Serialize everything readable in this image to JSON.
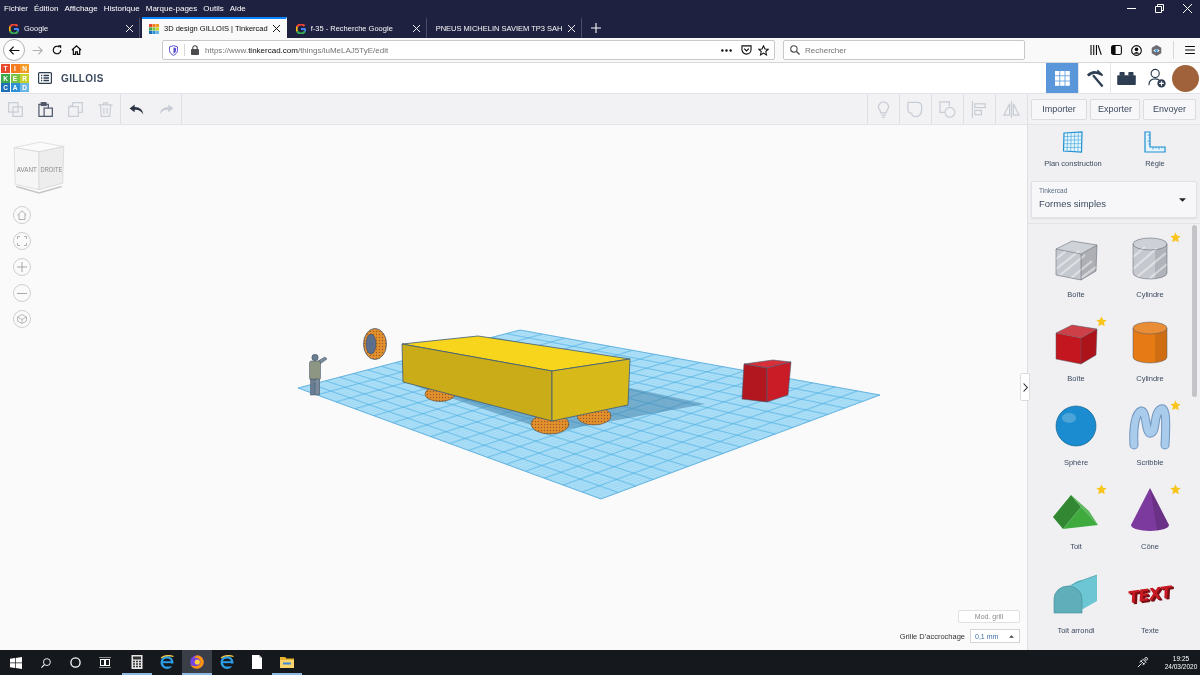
{
  "menu_bar": [
    "Fichier",
    "Édition",
    "Affichage",
    "Historique",
    "Marque-pages",
    "Outils",
    "Aide"
  ],
  "tabs": [
    {
      "title": "Google",
      "kind": "g-favicon",
      "selected": false
    },
    {
      "title": "3D design GILLOIS | Tinkercad",
      "kind": "grid-favicon",
      "selected": true
    },
    {
      "title": "f-35 - Recherche Google",
      "kind": "g-favicon",
      "selected": false
    },
    {
      "title": "PNEUS MICHELIN SAVIEM TP3 SAH",
      "kind": "plain",
      "selected": false
    }
  ],
  "address_bar": {
    "url": {
      "scheme": "https://www.",
      "domain": "tinkercad.com",
      "path": "/things/luMeLAJ5TyE/edit"
    },
    "search_placeholder": "Rechercher"
  },
  "app_header": {
    "logo": [
      {
        "letter": "T",
        "color": "#e84a2d"
      },
      {
        "letter": "I",
        "color": "#f47b20"
      },
      {
        "letter": "N",
        "color": "#f59a23"
      },
      {
        "letter": "K",
        "color": "#3ea74b"
      },
      {
        "letter": "E",
        "color": "#7cc242"
      },
      {
        "letter": "R",
        "color": "#c5d22b"
      },
      {
        "letter": "C",
        "color": "#1e6fb9"
      },
      {
        "letter": "A",
        "color": "#2d8fd5"
      },
      {
        "letter": "D",
        "color": "#6cb6e5"
      }
    ],
    "project_name": "GILLOIS",
    "modes": [
      {
        "kind": "grid",
        "selected": true
      },
      {
        "kind": "pickaxe",
        "selected": false
      },
      {
        "kind": "brick",
        "selected": false
      }
    ]
  },
  "toolbar": {
    "edit_tools": [
      {
        "kind": "copy",
        "disabled": true
      },
      {
        "kind": "paste",
        "disabled": false
      },
      {
        "kind": "duplicate",
        "disabled": true
      },
      {
        "kind": "delete",
        "disabled": true
      }
    ],
    "history_tools": [
      {
        "kind": "undo",
        "disabled": false
      },
      {
        "kind": "redo",
        "disabled": true
      }
    ],
    "view_tools": [
      {
        "kind": "lightbulb",
        "disabled": true
      },
      {
        "kind": "blob",
        "disabled": true
      },
      {
        "kind": "square-circle",
        "disabled": true
      },
      {
        "kind": "align",
        "disabled": true
      },
      {
        "kind": "mirror",
        "disabled": true
      }
    ],
    "actions": [
      "Importer",
      "Exporter",
      "Envoyer"
    ]
  },
  "view_cube": {
    "front": "AVANT",
    "right": "DROITE"
  },
  "grid_settings": {
    "edit_button": "Mod. grill",
    "snap_label": "Grille D'accrochage",
    "snap_value": "0,1 mm"
  },
  "panel": {
    "tools": [
      {
        "kind": "workplane",
        "label": "Plan construction"
      },
      {
        "kind": "ruler",
        "label": "Règle"
      }
    ],
    "library": {
      "label": "Tinkercad",
      "value": "Formes simples"
    },
    "shapes": [
      {
        "label": "Boîte",
        "kind": "hole-box",
        "color": "#c5c8cf",
        "starred": false
      },
      {
        "label": "Cylindre",
        "kind": "hole-cylinder",
        "color": "#c5c8cf",
        "starred": true
      },
      {
        "label": "Boîte",
        "kind": "box",
        "color": "#c4161f",
        "starred": true
      },
      {
        "label": "Cylindre",
        "kind": "cylinder",
        "color": "#e67a14",
        "starred": false
      },
      {
        "label": "Sphère",
        "kind": "sphere",
        "color": "#1a8ccf",
        "starred": false
      },
      {
        "label": "Scribble",
        "kind": "scribble",
        "color": "#a9cbec",
        "starred": true
      },
      {
        "label": "Toit",
        "kind": "roof",
        "color": "#3fab3f",
        "starred": true
      },
      {
        "label": "Cône",
        "kind": "cone",
        "color": "#7d3a9e",
        "starred": true
      },
      {
        "label": "Toit arrondi",
        "kind": "round-roof",
        "color": "#6dc6d4",
        "starred": false
      },
      {
        "label": "Texte",
        "kind": "text",
        "color": "#c81a22",
        "preview_text": "TEXT",
        "starred": false
      }
    ]
  },
  "taskbar": {
    "apps": [
      {
        "kind": "calculator",
        "running": true,
        "selected": false
      },
      {
        "kind": "e-browser",
        "running": false,
        "selected": false
      },
      {
        "kind": "fox-browser",
        "running": true,
        "selected": true
      },
      {
        "kind": "e-browser",
        "running": false,
        "selected": false
      },
      {
        "kind": "document",
        "running": false,
        "selected": false
      },
      {
        "kind": "folder",
        "running": true,
        "selected": false
      }
    ],
    "clock": {
      "time": "19:25",
      "date": "24/03/2020"
    }
  }
}
